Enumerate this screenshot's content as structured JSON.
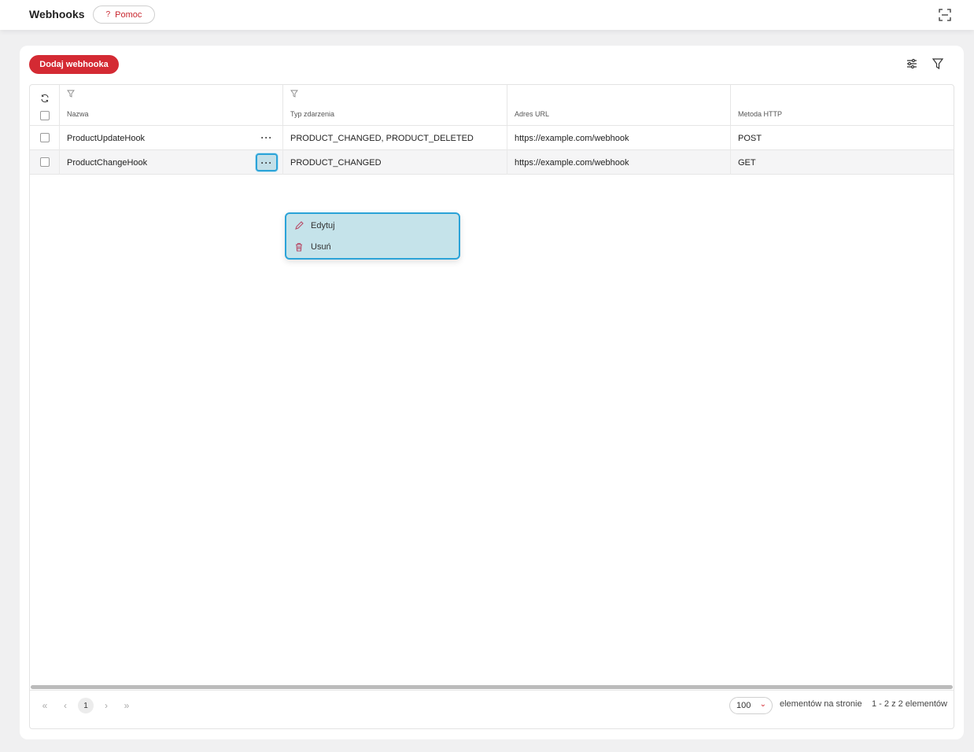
{
  "header": {
    "title": "Webhooks",
    "help_label": "Pomoc",
    "help_glyph": "?"
  },
  "toolbar": {
    "add_label": "Dodaj webhooka"
  },
  "table": {
    "columns": [
      "Nazwa",
      "Typ zdarzenia",
      "Adres URL",
      "Metoda HTTP"
    ],
    "rows": [
      {
        "name": "ProductUpdateHook",
        "events": "PRODUCT_CHANGED, PRODUCT_DELETED",
        "url": "https://example.com/webhook",
        "method": "POST"
      },
      {
        "name": "ProductChangeHook",
        "events": "PRODUCT_CHANGED",
        "url": "https://example.com/webhook",
        "method": "GET"
      }
    ],
    "row_menu_glyph": "···"
  },
  "context_menu": {
    "edit_label": "Edytuj",
    "delete_label": "Usuń"
  },
  "pager": {
    "current_page": "1",
    "page_size": "100",
    "per_page_label": "elementów na stronie",
    "range_label": "1 - 2 z 2 elementów"
  },
  "colors": {
    "accent": "#d42a33",
    "highlight": "#2ba3d8"
  }
}
